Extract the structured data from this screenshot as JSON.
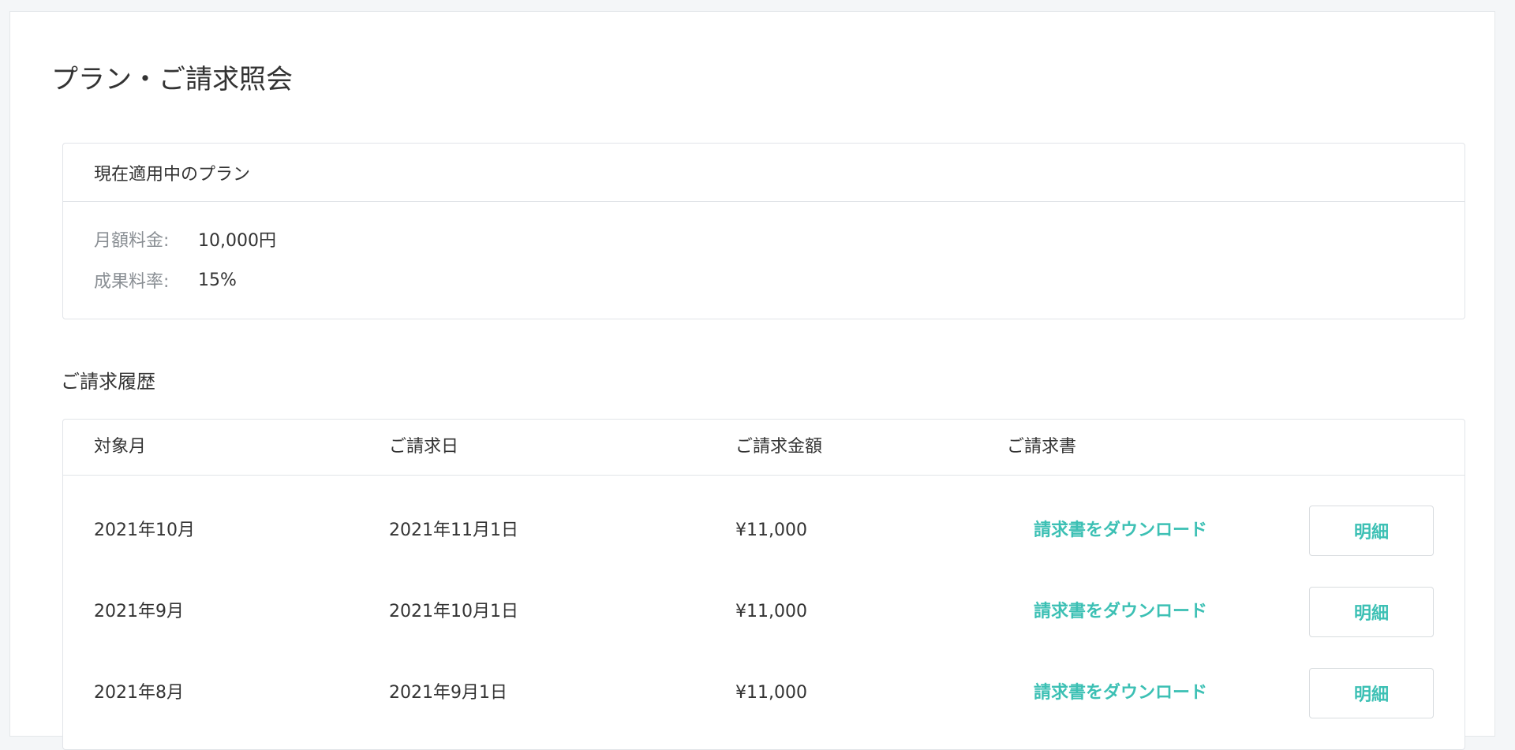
{
  "page": {
    "title": "プラン・ご請求照会"
  },
  "plan": {
    "header": "現在適用中のプラン",
    "rows": [
      {
        "label": "月額料金:",
        "value": "10,000円"
      },
      {
        "label": "成果料率:",
        "value": "15%"
      }
    ]
  },
  "history": {
    "title": "ご請求履歴",
    "columns": {
      "month": "対象月",
      "date": "ご請求日",
      "amount": "ご請求金額",
      "invoice": "ご請求書"
    },
    "rows": [
      {
        "month": "2021年10月",
        "date": "2021年11月1日",
        "amount": "¥11,000",
        "download": "請求書をダウンロード",
        "detail": "明細"
      },
      {
        "month": "2021年9月",
        "date": "2021年10月1日",
        "amount": "¥11,000",
        "download": "請求書をダウンロード",
        "detail": "明細"
      },
      {
        "month": "2021年8月",
        "date": "2021年9月1日",
        "amount": "¥11,000",
        "download": "請求書をダウンロード",
        "detail": "明細"
      }
    ]
  },
  "colors": {
    "accent": "#3cc0b4",
    "background": "#f4f6f8",
    "border": "#e1e4e8",
    "muted_text": "#8a8f94"
  }
}
